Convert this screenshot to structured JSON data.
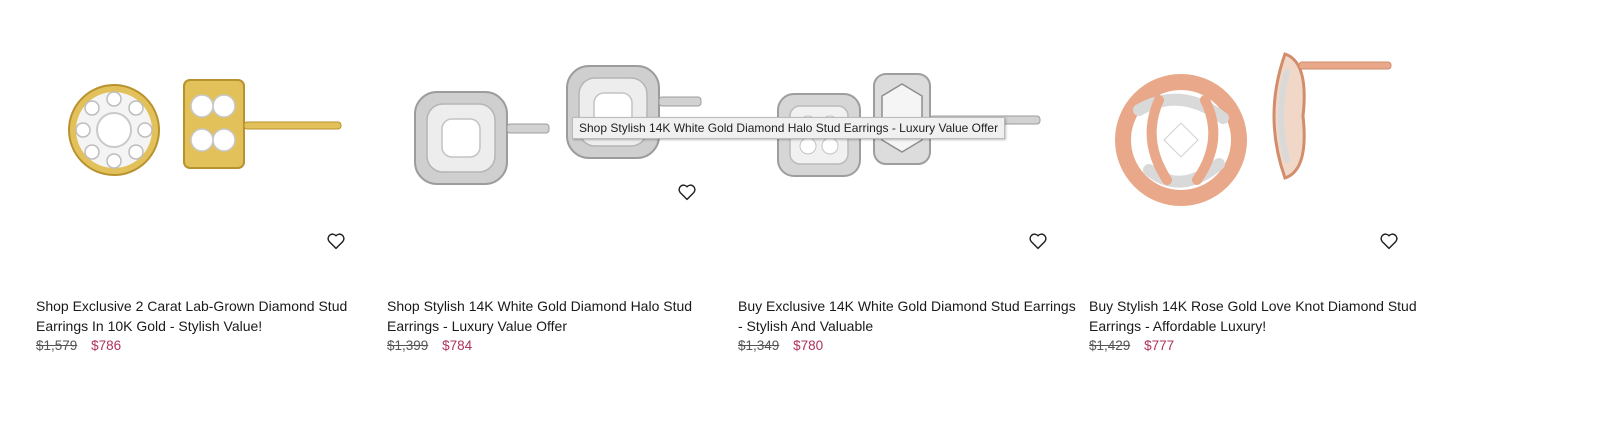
{
  "products": [
    {
      "title": "Shop Exclusive 2 Carat Lab-Grown Diamond Stud Earrings In 10K Gold - Stylish Value!",
      "old_price": "$1,579",
      "new_price": "$786",
      "image_icon": "gold-halo-stud-earring-image"
    },
    {
      "title": "Shop Stylish 14K White Gold Diamond Halo Stud Earrings - Luxury Value Offer",
      "old_price": "$1,399",
      "new_price": "$784",
      "image_icon": "white-gold-cushion-halo-earring-image"
    },
    {
      "title": "Buy Exclusive 14K White Gold Diamond Stud Earrings - Stylish And Valuable",
      "old_price": "$1,349",
      "new_price": "$780",
      "image_icon": "white-gold-square-stud-earring-image"
    },
    {
      "title": "Buy Stylish 14K Rose Gold Love Knot Diamond Stud Earrings - Affordable Luxury!",
      "old_price": "$1,429",
      "new_price": "$777",
      "image_icon": "rose-gold-love-knot-earring-image"
    }
  ],
  "tooltip": "Shop Stylish 14K White Gold Diamond Halo Stud Earrings - Luxury Value Offer",
  "wishlist_icon": "heart-outline-icon",
  "colors": {
    "sale_price": "#b0325b",
    "old_price": "#555555",
    "gold": "#e3c15a",
    "white_gold": "#d9d9d9",
    "rose_gold": "#e8a889"
  }
}
